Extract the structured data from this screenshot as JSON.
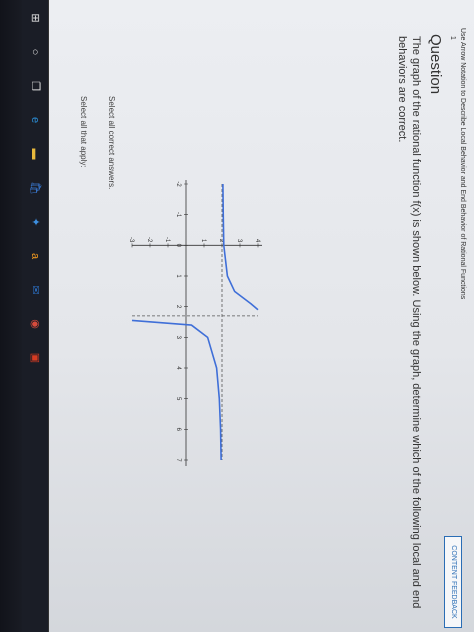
{
  "header": {
    "breadcrumb": "Use Arrow Notation to Describe Local Behavior and End Behavior of Rational Functions",
    "step": "1",
    "title": "Question",
    "feedback_button": "CONTENT FEEDBACK"
  },
  "question": {
    "line1": "The graph of the rational function f(x) is shown below. Using the graph, determine which of the following local and end",
    "line2": "behaviors are correct.",
    "select_hint": "Select all correct answers.",
    "select_apply": "Select all that apply:"
  },
  "graph": {
    "x_ticks": [
      "-2",
      "-1",
      "0",
      "1",
      "2",
      "3",
      "4",
      "5",
      "6",
      "7"
    ],
    "y_ticks": [
      "-3",
      "-2",
      "-1",
      "1",
      "2",
      "3",
      "4"
    ]
  },
  "chart_data": {
    "type": "line",
    "title": "",
    "xlabel": "",
    "ylabel": "",
    "xlim": [
      -2,
      7
    ],
    "ylim": [
      -3,
      4
    ],
    "grid": false,
    "asymptotes": {
      "vertical_x": 2.3,
      "horizontal_y": 2
    },
    "series": [
      {
        "x": [
          -2,
          -1,
          0,
          1,
          1.5,
          1.9,
          2.1
        ],
        "y": [
          2.05,
          2.07,
          2.1,
          2.3,
          2.7,
          3.6,
          4
        ]
      },
      {
        "x": [
          2.45,
          2.6,
          3,
          4,
          5,
          6,
          7
        ],
        "y": [
          -3,
          0.3,
          1.2,
          1.7,
          1.85,
          1.92,
          1.95
        ]
      }
    ]
  },
  "taskbar": {
    "icons": [
      "windows-start-icon",
      "search-icon",
      "task-view-icon",
      "edge-browser-icon",
      "file-explorer-icon",
      "store-icon",
      "dropbox-icon",
      "amazon-icon",
      "mail-icon",
      "chrome-icon",
      "office-icon"
    ]
  },
  "colors": {
    "accent": "#2a6db5",
    "curve": "#3f6fd8",
    "asymptote": "#555555"
  }
}
